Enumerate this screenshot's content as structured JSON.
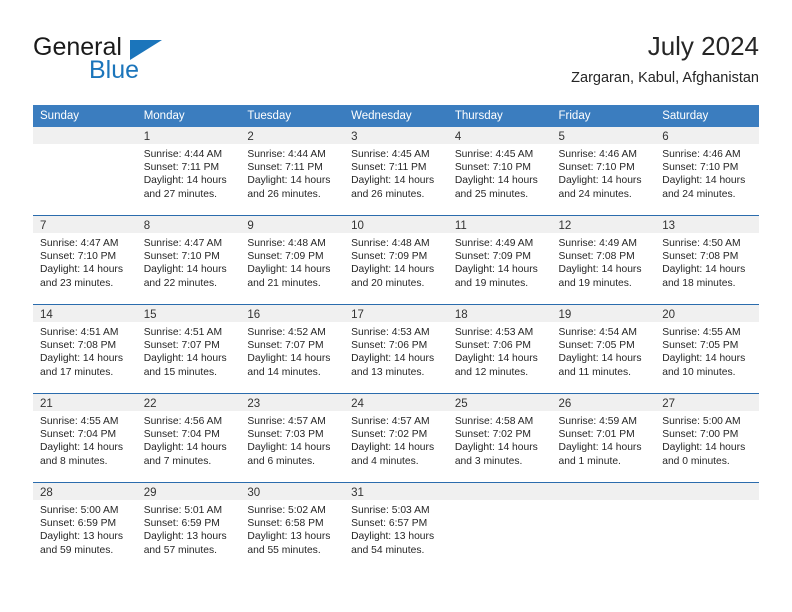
{
  "brand": {
    "name_line1": "General",
    "name_line2": "Blue",
    "accent_color": "#1b75bb"
  },
  "header": {
    "title": "July 2024",
    "subtitle": "Zargaran, Kabul, Afghanistan"
  },
  "theme": {
    "header_row_bg": "#3b7dbf",
    "daynum_band_bg": "#f0f0f0",
    "row_divider": "#2b6cad"
  },
  "weekday_headers": [
    "Sunday",
    "Monday",
    "Tuesday",
    "Wednesday",
    "Thursday",
    "Friday",
    "Saturday"
  ],
  "weeks": [
    [
      {
        "day": "",
        "sunrise": "",
        "sunset": "",
        "daylight_line1": "",
        "daylight_line2": "",
        "empty": true
      },
      {
        "day": "1",
        "sunrise": "Sunrise: 4:44 AM",
        "sunset": "Sunset: 7:11 PM",
        "daylight_line1": "Daylight: 14 hours",
        "daylight_line2": "and 27 minutes."
      },
      {
        "day": "2",
        "sunrise": "Sunrise: 4:44 AM",
        "sunset": "Sunset: 7:11 PM",
        "daylight_line1": "Daylight: 14 hours",
        "daylight_line2": "and 26 minutes."
      },
      {
        "day": "3",
        "sunrise": "Sunrise: 4:45 AM",
        "sunset": "Sunset: 7:11 PM",
        "daylight_line1": "Daylight: 14 hours",
        "daylight_line2": "and 26 minutes."
      },
      {
        "day": "4",
        "sunrise": "Sunrise: 4:45 AM",
        "sunset": "Sunset: 7:10 PM",
        "daylight_line1": "Daylight: 14 hours",
        "daylight_line2": "and 25 minutes."
      },
      {
        "day": "5",
        "sunrise": "Sunrise: 4:46 AM",
        "sunset": "Sunset: 7:10 PM",
        "daylight_line1": "Daylight: 14 hours",
        "daylight_line2": "and 24 minutes."
      },
      {
        "day": "6",
        "sunrise": "Sunrise: 4:46 AM",
        "sunset": "Sunset: 7:10 PM",
        "daylight_line1": "Daylight: 14 hours",
        "daylight_line2": "and 24 minutes."
      }
    ],
    [
      {
        "day": "7",
        "sunrise": "Sunrise: 4:47 AM",
        "sunset": "Sunset: 7:10 PM",
        "daylight_line1": "Daylight: 14 hours",
        "daylight_line2": "and 23 minutes."
      },
      {
        "day": "8",
        "sunrise": "Sunrise: 4:47 AM",
        "sunset": "Sunset: 7:10 PM",
        "daylight_line1": "Daylight: 14 hours",
        "daylight_line2": "and 22 minutes."
      },
      {
        "day": "9",
        "sunrise": "Sunrise: 4:48 AM",
        "sunset": "Sunset: 7:09 PM",
        "daylight_line1": "Daylight: 14 hours",
        "daylight_line2": "and 21 minutes."
      },
      {
        "day": "10",
        "sunrise": "Sunrise: 4:48 AM",
        "sunset": "Sunset: 7:09 PM",
        "daylight_line1": "Daylight: 14 hours",
        "daylight_line2": "and 20 minutes."
      },
      {
        "day": "11",
        "sunrise": "Sunrise: 4:49 AM",
        "sunset": "Sunset: 7:09 PM",
        "daylight_line1": "Daylight: 14 hours",
        "daylight_line2": "and 19 minutes."
      },
      {
        "day": "12",
        "sunrise": "Sunrise: 4:49 AM",
        "sunset": "Sunset: 7:08 PM",
        "daylight_line1": "Daylight: 14 hours",
        "daylight_line2": "and 19 minutes."
      },
      {
        "day": "13",
        "sunrise": "Sunrise: 4:50 AM",
        "sunset": "Sunset: 7:08 PM",
        "daylight_line1": "Daylight: 14 hours",
        "daylight_line2": "and 18 minutes."
      }
    ],
    [
      {
        "day": "14",
        "sunrise": "Sunrise: 4:51 AM",
        "sunset": "Sunset: 7:08 PM",
        "daylight_line1": "Daylight: 14 hours",
        "daylight_line2": "and 17 minutes."
      },
      {
        "day": "15",
        "sunrise": "Sunrise: 4:51 AM",
        "sunset": "Sunset: 7:07 PM",
        "daylight_line1": "Daylight: 14 hours",
        "daylight_line2": "and 15 minutes."
      },
      {
        "day": "16",
        "sunrise": "Sunrise: 4:52 AM",
        "sunset": "Sunset: 7:07 PM",
        "daylight_line1": "Daylight: 14 hours",
        "daylight_line2": "and 14 minutes."
      },
      {
        "day": "17",
        "sunrise": "Sunrise: 4:53 AM",
        "sunset": "Sunset: 7:06 PM",
        "daylight_line1": "Daylight: 14 hours",
        "daylight_line2": "and 13 minutes."
      },
      {
        "day": "18",
        "sunrise": "Sunrise: 4:53 AM",
        "sunset": "Sunset: 7:06 PM",
        "daylight_line1": "Daylight: 14 hours",
        "daylight_line2": "and 12 minutes."
      },
      {
        "day": "19",
        "sunrise": "Sunrise: 4:54 AM",
        "sunset": "Sunset: 7:05 PM",
        "daylight_line1": "Daylight: 14 hours",
        "daylight_line2": "and 11 minutes."
      },
      {
        "day": "20",
        "sunrise": "Sunrise: 4:55 AM",
        "sunset": "Sunset: 7:05 PM",
        "daylight_line1": "Daylight: 14 hours",
        "daylight_line2": "and 10 minutes."
      }
    ],
    [
      {
        "day": "21",
        "sunrise": "Sunrise: 4:55 AM",
        "sunset": "Sunset: 7:04 PM",
        "daylight_line1": "Daylight: 14 hours",
        "daylight_line2": "and 8 minutes."
      },
      {
        "day": "22",
        "sunrise": "Sunrise: 4:56 AM",
        "sunset": "Sunset: 7:04 PM",
        "daylight_line1": "Daylight: 14 hours",
        "daylight_line2": "and 7 minutes."
      },
      {
        "day": "23",
        "sunrise": "Sunrise: 4:57 AM",
        "sunset": "Sunset: 7:03 PM",
        "daylight_line1": "Daylight: 14 hours",
        "daylight_line2": "and 6 minutes."
      },
      {
        "day": "24",
        "sunrise": "Sunrise: 4:57 AM",
        "sunset": "Sunset: 7:02 PM",
        "daylight_line1": "Daylight: 14 hours",
        "daylight_line2": "and 4 minutes."
      },
      {
        "day": "25",
        "sunrise": "Sunrise: 4:58 AM",
        "sunset": "Sunset: 7:02 PM",
        "daylight_line1": "Daylight: 14 hours",
        "daylight_line2": "and 3 minutes."
      },
      {
        "day": "26",
        "sunrise": "Sunrise: 4:59 AM",
        "sunset": "Sunset: 7:01 PM",
        "daylight_line1": "Daylight: 14 hours",
        "daylight_line2": "and 1 minute."
      },
      {
        "day": "27",
        "sunrise": "Sunrise: 5:00 AM",
        "sunset": "Sunset: 7:00 PM",
        "daylight_line1": "Daylight: 14 hours",
        "daylight_line2": "and 0 minutes."
      }
    ],
    [
      {
        "day": "28",
        "sunrise": "Sunrise: 5:00 AM",
        "sunset": "Sunset: 6:59 PM",
        "daylight_line1": "Daylight: 13 hours",
        "daylight_line2": "and 59 minutes."
      },
      {
        "day": "29",
        "sunrise": "Sunrise: 5:01 AM",
        "sunset": "Sunset: 6:59 PM",
        "daylight_line1": "Daylight: 13 hours",
        "daylight_line2": "and 57 minutes."
      },
      {
        "day": "30",
        "sunrise": "Sunrise: 5:02 AM",
        "sunset": "Sunset: 6:58 PM",
        "daylight_line1": "Daylight: 13 hours",
        "daylight_line2": "and 55 minutes."
      },
      {
        "day": "31",
        "sunrise": "Sunrise: 5:03 AM",
        "sunset": "Sunset: 6:57 PM",
        "daylight_line1": "Daylight: 13 hours",
        "daylight_line2": "and 54 minutes."
      },
      {
        "day": "",
        "sunrise": "",
        "sunset": "",
        "daylight_line1": "",
        "daylight_line2": "",
        "empty": true,
        "blank": true
      },
      {
        "day": "",
        "sunrise": "",
        "sunset": "",
        "daylight_line1": "",
        "daylight_line2": "",
        "empty": true,
        "blank": true
      },
      {
        "day": "",
        "sunrise": "",
        "sunset": "",
        "daylight_line1": "",
        "daylight_line2": "",
        "empty": true,
        "blank": true
      }
    ]
  ]
}
